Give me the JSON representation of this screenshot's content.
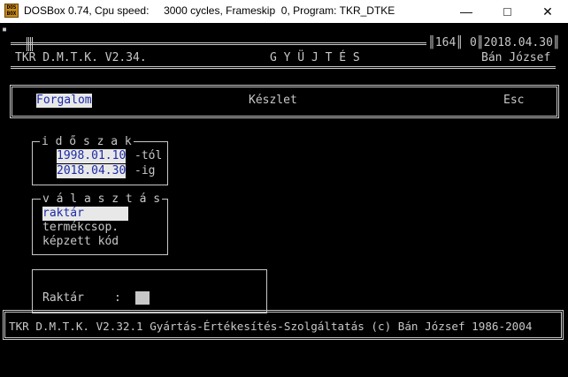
{
  "window": {
    "title": "DOSBox 0.74, Cpu speed:     3000 cycles, Frameskip  0, Program: TKR_DTKE",
    "icon_text": "DOS BOX",
    "minimize_glyph": "—",
    "close_glyph": "✕"
  },
  "header": {
    "counter1": "164",
    "counter2": "0",
    "date": "2018.04.30",
    "program": "TKR D.M.T.K. V2.34.",
    "section": "G Y Ü J T É S",
    "user": "Bán József"
  },
  "menu": {
    "items": [
      "Forgalom",
      "Készlet",
      "Esc"
    ],
    "selected": "Forgalom"
  },
  "period": {
    "legend": "i d ő s z a k",
    "from_date": "1998.01.10",
    "from_suffix": "-tól",
    "to_date": "2018.04.30",
    "to_suffix": "-ig"
  },
  "selection": {
    "legend": "v á l a s z t á s",
    "options": [
      "raktár",
      "termékcsop.",
      "képzett kód"
    ],
    "selected": "raktár"
  },
  "input": {
    "label": "Raktár",
    "colon": ":"
  },
  "footer": {
    "text": "TKR D.M.T.K. V2.32.1 Gyártás-Értékesítés-Szolgáltatás (c) Bán József 1986-2004"
  }
}
